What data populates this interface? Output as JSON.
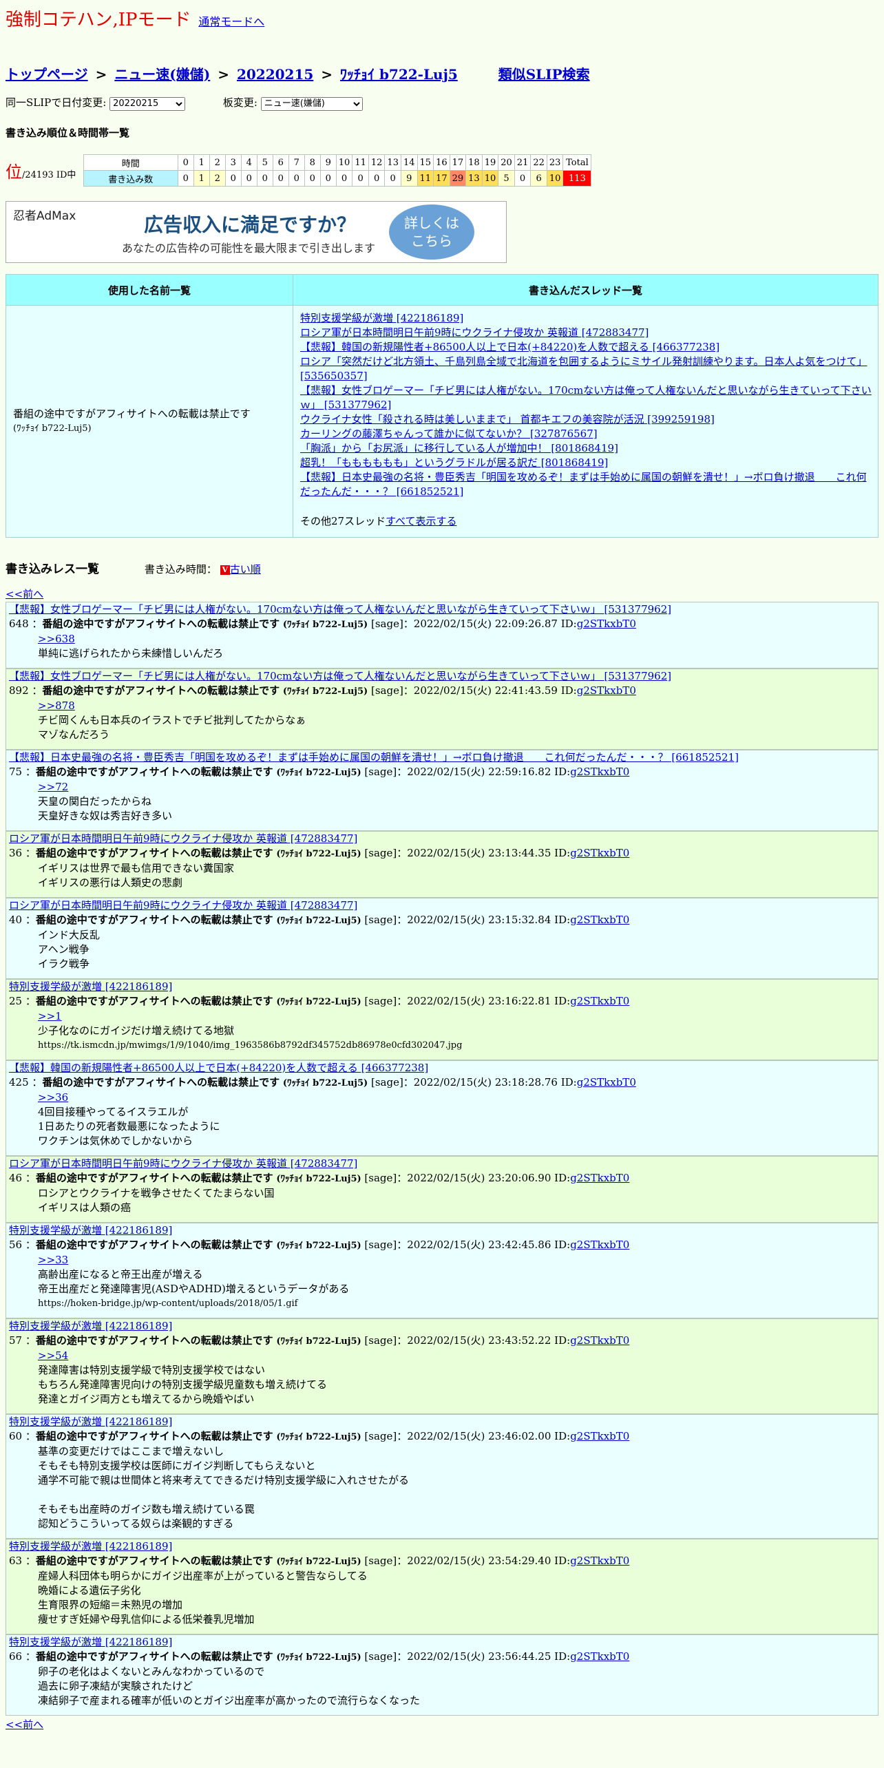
{
  "mode": {
    "title": "強制コテハン,IPモード",
    "normal_link": "通常モードへ"
  },
  "breadcrumb": {
    "items": [
      "トップページ",
      "ニュー速(嫌儲)",
      "20220215",
      "ﾜｯﾁｮｲ b722-Luj5"
    ],
    "separator": ">",
    "similar": "類似SLIP検索"
  },
  "selectors": {
    "date_label": "同一SLIPで日付変更:",
    "date_value": "20220215",
    "board_label": "板変更:",
    "board_value": "ニュー速(嫌儲)"
  },
  "ranking": {
    "section_title": "書き込み順位＆時間帯一覧",
    "rank_big": "位",
    "rank_text": "/24193 ID中",
    "row_time_label": "時間",
    "row_count_label": "書き込み数",
    "hours": [
      "0",
      "1",
      "2",
      "3",
      "4",
      "5",
      "6",
      "7",
      "8",
      "9",
      "10",
      "11",
      "12",
      "13",
      "14",
      "15",
      "16",
      "17",
      "18",
      "19",
      "20",
      "21",
      "22",
      "23",
      "Total"
    ],
    "counts": [
      "0",
      "1",
      "2",
      "0",
      "0",
      "0",
      "0",
      "0",
      "0",
      "0",
      "0",
      "0",
      "0",
      "0",
      "9",
      "11",
      "17",
      "29",
      "13",
      "10",
      "5",
      "0",
      "6",
      "10",
      "113"
    ],
    "count_colors": [
      "#ffffff",
      "#ffffcc",
      "#ffffcc",
      "#ffffff",
      "#ffffff",
      "#ffffff",
      "#ffffff",
      "#ffffff",
      "#ffffff",
      "#ffffff",
      "#ffffff",
      "#ffffff",
      "#ffffff",
      "#ffffff",
      "#ffffcc",
      "#ffdd55",
      "#ffdd55",
      "#ff8866",
      "#ffdd55",
      "#ffdd55",
      "#ffffcc",
      "#ffffff",
      "#ffffcc",
      "#ffdd55",
      "#ff0000"
    ]
  },
  "ad": {
    "logo": "忍者AdMax",
    "headline": "広告収入に満足ですか？",
    "sub": "あなたの広告枠の可能性を最大限まで引き出します",
    "cta_line1": "詳しくは",
    "cta_line2": "こちら"
  },
  "summary": {
    "names_header": "使用した名前一覧",
    "threads_header": "書き込んだスレッド一覧",
    "name": "番組の途中ですがアフィサイトへの転載は禁止です",
    "trip": "(ﾜｯﾁｮｲ b722-Luj5)",
    "threads": [
      "特別支援学級が激増 [422186189]",
      "ロシア軍が日本時間明日午前9時にウクライナ侵攻か 英報道 [472883477]",
      "【悲報】韓国の新規陽性者+86500人以上で日本(+84220)を人数で超える [466377238]",
      "ロシア「突然だけど北方領土、千島列島全域で北海道を包囲するようにミサイル発射訓練やります。日本人よ気をつけて」 [535650357]",
      "【悲報】女性ブロゲーマー「チビ男には人権がない。170cmない方は俺って人権ないんだと思いながら生きていって下さいｗ」 [531377962]",
      "ウクライナ女性「殺される時は美しいままで」 首都キエフの美容院が活況 [399259198]",
      "カーリングの藤澤ちゃんって誰かに似てないか？ [327876567]",
      "「胸派」から「お尻派」に移行している人が増加中！ [801868419]",
      "超乳！「もももももも」というグラドルが居る訳だ [801868419]",
      "【悲報】日本史最強の名将・豊臣秀吉「明国を攻めるぞ！まずは手始めに属国の朝鮮を潰せ！」→ボロ負け撤退　　これ何だったんだ・・・？ [661852521]"
    ],
    "more_prefix": "その他27スレッド",
    "more_link": "すべて表示する"
  },
  "posts_section": {
    "title": "書き込みレス一覧",
    "time_label": "書き込み時間：",
    "badge": "V",
    "order_link": "古い順",
    "prev_top": "<<前へ",
    "prev_bottom": "<<前へ"
  },
  "posts": [
    {
      "thread": "【悲報】女性ブロゲーマー「チビ男には人権がない。170cmない方は俺って人権ないんだと思いながら生きていって下さいｗ」 [531377962]",
      "num": "648",
      "name": "番組の途中ですがアフィサイトへの転載は禁止です",
      "trip": "(ﾜｯﾁｮｲ b722-Luj5)",
      "meta": " [sage]：2022/02/15(火) 22:09:26.87 ID:",
      "id": "g2STkxbT0",
      "anchor": ">>638",
      "lines": [
        "単純に逃げられたから未練惜しいんだろ"
      ]
    },
    {
      "thread": "【悲報】女性ブロゲーマー「チビ男には人権がない。170cmない方は俺って人権ないんだと思いながら生きていって下さいｗ」 [531377962]",
      "num": "892",
      "name": "番組の途中ですがアフィサイトへの転載は禁止です",
      "trip": "(ﾜｯﾁｮｲ b722-Luj5)",
      "meta": " [sage]：2022/02/15(火) 22:41:43.59 ID:",
      "id": "g2STkxbT0",
      "anchor": ">>878",
      "lines": [
        "チビ岡くんも日本兵のイラストでチビ批判してたからなぁ",
        "マゾなんだろう"
      ]
    },
    {
      "thread": "【悲報】日本史最強の名将・豊臣秀吉「明国を攻めるぞ！まずは手始めに属国の朝鮮を潰せ！」→ボロ負け撤退　　これ何だったんだ・・・？ [661852521]",
      "num": "75",
      "name": "番組の途中ですがアフィサイトへの転載は禁止です",
      "trip": "(ﾜｯﾁｮｲ b722-Luj5)",
      "meta": " [sage]：2022/02/15(火) 22:59:16.82 ID:",
      "id": "g2STkxbT0",
      "anchor": ">>72",
      "lines": [
        "天皇の関白だったからね",
        "天皇好きな奴は秀吉好き多い"
      ]
    },
    {
      "thread": "ロシア軍が日本時間明日午前9時にウクライナ侵攻か 英報道 [472883477]",
      "num": "36",
      "name": "番組の途中ですがアフィサイトへの転載は禁止です",
      "trip": "(ﾜｯﾁｮｲ b722-Luj5)",
      "meta": " [sage]：2022/02/15(火) 23:13:44.35 ID:",
      "id": "g2STkxbT0",
      "anchor": "",
      "lines": [
        "イギリスは世界で最も信用できない糞国家",
        "イギリスの悪行は人類史の悲劇"
      ]
    },
    {
      "thread": "ロシア軍が日本時間明日午前9時にウクライナ侵攻か 英報道 [472883477]",
      "num": "40",
      "name": "番組の途中ですがアフィサイトへの転載は禁止です",
      "trip": "(ﾜｯﾁｮｲ b722-Luj5)",
      "meta": " [sage]：2022/02/15(火) 23:15:32.84 ID:",
      "id": "g2STkxbT0",
      "anchor": "",
      "lines": [
        "インド大反乱",
        "アヘン戦争",
        "イラク戦争"
      ]
    },
    {
      "thread": "特別支援学級が激増 [422186189]",
      "num": "25",
      "name": "番組の途中ですがアフィサイトへの転載は禁止です",
      "trip": "(ﾜｯﾁｮｲ b722-Luj5)",
      "meta": " [sage]：2022/02/15(火) 23:16:22.81 ID:",
      "id": "g2STkxbT0",
      "anchor": ">>1",
      "lines": [
        "少子化なのにガイジだけ増え続けてる地獄"
      ],
      "url": "https://tk.ismcdn.jp/mwimgs/1/9/1040/img_1963586b8792df345752db86978e0cfd302047.jpg"
    },
    {
      "thread": "【悲報】韓国の新規陽性者+86500人以上で日本(+84220)を人数で超える [466377238]",
      "num": "425",
      "name": "番組の途中ですがアフィサイトへの転載は禁止です",
      "trip": "(ﾜｯﾁｮｲ b722-Luj5)",
      "meta": " [sage]：2022/02/15(火) 23:18:28.76 ID:",
      "id": "g2STkxbT0",
      "anchor": ">>36",
      "lines": [
        "4回目接種やってるイスラエルが",
        "1日あたりの死者数最悪になったように",
        "ワクチンは気休めでしかないから"
      ]
    },
    {
      "thread": "ロシア軍が日本時間明日午前9時にウクライナ侵攻か 英報道 [472883477]",
      "num": "46",
      "name": "番組の途中ですがアフィサイトへの転載は禁止です",
      "trip": "(ﾜｯﾁｮｲ b722-Luj5)",
      "meta": " [sage]：2022/02/15(火) 23:20:06.90 ID:",
      "id": "g2STkxbT0",
      "anchor": "",
      "lines": [
        "ロシアとウクライナを戦争させたくてたまらない国",
        "イギリスは人類の癌"
      ]
    },
    {
      "thread": "特別支援学級が激増 [422186189]",
      "num": "56",
      "name": "番組の途中ですがアフィサイトへの転載は禁止です",
      "trip": "(ﾜｯﾁｮｲ b722-Luj5)",
      "meta": " [sage]：2022/02/15(火) 23:42:45.86 ID:",
      "id": "g2STkxbT0",
      "anchor": ">>33",
      "lines": [
        "高齢出産になると帝王出産が増える",
        "帝王出産だと発達障害児(ASDやADHD)増えるというデータがある"
      ],
      "url": "https://hoken-bridge.jp/wp-content/uploads/2018/05/1.gif"
    },
    {
      "thread": "特別支援学級が激増 [422186189]",
      "num": "57",
      "name": "番組の途中ですがアフィサイトへの転載は禁止です",
      "trip": "(ﾜｯﾁｮｲ b722-Luj5)",
      "meta": " [sage]：2022/02/15(火) 23:43:52.22 ID:",
      "id": "g2STkxbT0",
      "anchor": ">>54",
      "lines": [
        "発達障害は特別支援学級で特別支援学校ではない",
        "もちろん発達障害児向けの特別支援学級児童数も増え続けてる",
        "発達とガイジ両方とも増えてるから晩婚やばい"
      ]
    },
    {
      "thread": "特別支援学級が激増 [422186189]",
      "num": "60",
      "name": "番組の途中ですがアフィサイトへの転載は禁止です",
      "trip": "(ﾜｯﾁｮｲ b722-Luj5)",
      "meta": " [sage]：2022/02/15(火) 23:46:02.00 ID:",
      "id": "g2STkxbT0",
      "anchor": "",
      "lines": [
        "基準の変更だけではここまで増えないし",
        "そもそも特別支援学校は医師にガイジ判断してもらえないと",
        "通学不可能で親は世間体と将来考えてできるだけ特別支援学級に入れさせたがる",
        "",
        "そもそも出産時のガイジ数も増え続けている罠",
        "認知どうこういってる奴らは楽観的すぎる"
      ]
    },
    {
      "thread": "特別支援学級が激増 [422186189]",
      "num": "63",
      "name": "番組の途中ですがアフィサイトへの転載は禁止です",
      "trip": "(ﾜｯﾁｮｲ b722-Luj5)",
      "meta": " [sage]：2022/02/15(火) 23:54:29.40 ID:",
      "id": "g2STkxbT0",
      "anchor": "",
      "lines": [
        "産婦人科団体も明らかにガイジ出産率が上がっていると警告ならしてる",
        "晩婚による遺伝子劣化",
        "生育限界の短縮＝未熟児の増加",
        "痩せすぎ妊婦や母乳信仰による低栄養乳児増加"
      ]
    },
    {
      "thread": "特別支援学級が激増 [422186189]",
      "num": "66",
      "name": "番組の途中ですがアフィサイトへの転載は禁止です",
      "trip": "(ﾜｯﾁｮｲ b722-Luj5)",
      "meta": " [sage]：2022/02/15(火) 23:56:44.25 ID:",
      "id": "g2STkxbT0",
      "anchor": "",
      "lines": [
        "卵子の老化はよくないとみんなわかっているので",
        "過去に卵子凍結が実験されたけど",
        "凍結卵子で産まれる確率が低いのとガイジ出産率が高かったので流行らなくなった"
      ]
    }
  ]
}
